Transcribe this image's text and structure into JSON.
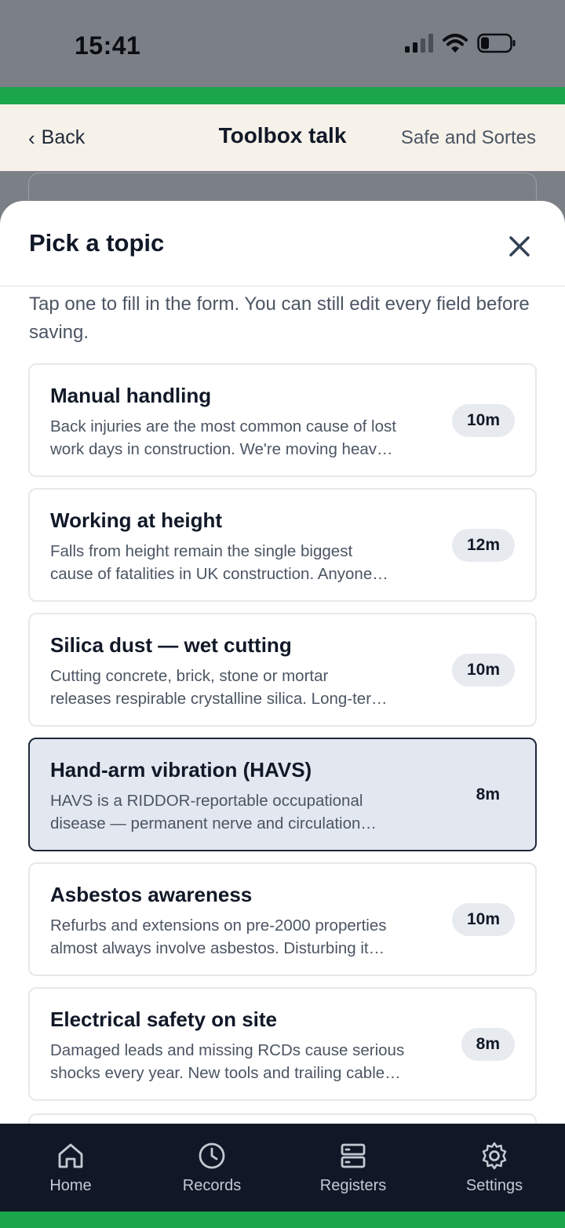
{
  "status_bar": {
    "time": "15:41"
  },
  "header": {
    "back_label": "Back",
    "title": "Toolbox talk",
    "org_name": "Safe and Sortes"
  },
  "sheet": {
    "title": "Pick a topic",
    "intro": "Tap one to fill in the form. You can still edit every field before saving.",
    "topics": [
      {
        "title": "Manual handling",
        "desc_line1": "Back injuries are the most common cause of lost",
        "desc_line2": "work days in construction. We're moving heav…",
        "duration": "10m",
        "selected": false
      },
      {
        "title": "Working at height",
        "desc_line1": "Falls from height remain the single biggest",
        "desc_line2": "cause of fatalities in UK construction. Anyone…",
        "duration": "12m",
        "selected": false
      },
      {
        "title": "Silica dust — wet cutting",
        "desc_line1": "Cutting concrete, brick, stone or mortar",
        "desc_line2": "releases respirable crystalline silica. Long-ter…",
        "duration": "10m",
        "selected": false
      },
      {
        "title": "Hand-arm vibration (HAVS)",
        "desc_line1": "HAVS is a RIDDOR-reportable occupational",
        "desc_line2": "disease — permanent nerve and circulation…",
        "duration": "8m",
        "selected": true
      },
      {
        "title": "Asbestos awareness",
        "desc_line1": "Refurbs and extensions on pre-2000 properties",
        "desc_line2": "almost always involve asbestos. Disturbing it…",
        "duration": "10m",
        "selected": false
      },
      {
        "title": "Electrical safety on site",
        "desc_line1": "Damaged leads and missing RCDs cause serious",
        "desc_line2": "shocks every year. New tools and trailing cable…",
        "duration": "8m",
        "selected": false
      }
    ]
  },
  "tab_bar": {
    "items": [
      {
        "label": "Home",
        "icon": "home-icon"
      },
      {
        "label": "Records",
        "icon": "clock-icon"
      },
      {
        "label": "Registers",
        "icon": "server-icon"
      },
      {
        "label": "Settings",
        "icon": "gear-icon"
      }
    ]
  },
  "colors": {
    "brand_green": "#1ba64c",
    "tab_bar_bg": "#101828",
    "header_bg": "#f6f2ea",
    "selected_bg": "#e3e8f0"
  }
}
